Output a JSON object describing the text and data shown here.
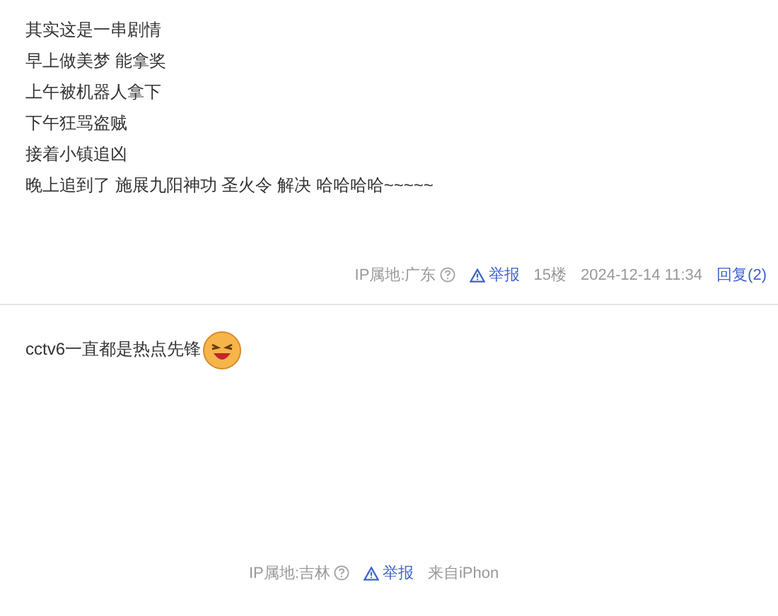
{
  "posts": [
    {
      "lines": [
        "其实这是一串剧情",
        "早上做美梦 能拿奖",
        "上午被机器人拿下",
        "下午狂骂盗贼",
        "接着小镇追凶",
        "晚上追到了 施展九阳神功 圣火令 解决 哈哈哈哈~~~~~"
      ],
      "emoji": false,
      "meta": [
        {
          "kind": "ip",
          "text": "IP属地:广东"
        },
        {
          "kind": "report",
          "text": "举报"
        },
        {
          "kind": "text",
          "text": "15楼"
        },
        {
          "kind": "text",
          "text": "2024-12-14 11:34"
        },
        {
          "kind": "link",
          "text": "回复(2)"
        }
      ]
    },
    {
      "lines": [
        "cctv6一直都是热点先锋"
      ],
      "emoji": true,
      "meta": [
        {
          "kind": "ip",
          "text": "IP属地:吉林"
        },
        {
          "kind": "report",
          "text": "举报"
        },
        {
          "kind": "text",
          "text": "来自iPhon"
        }
      ]
    }
  ]
}
